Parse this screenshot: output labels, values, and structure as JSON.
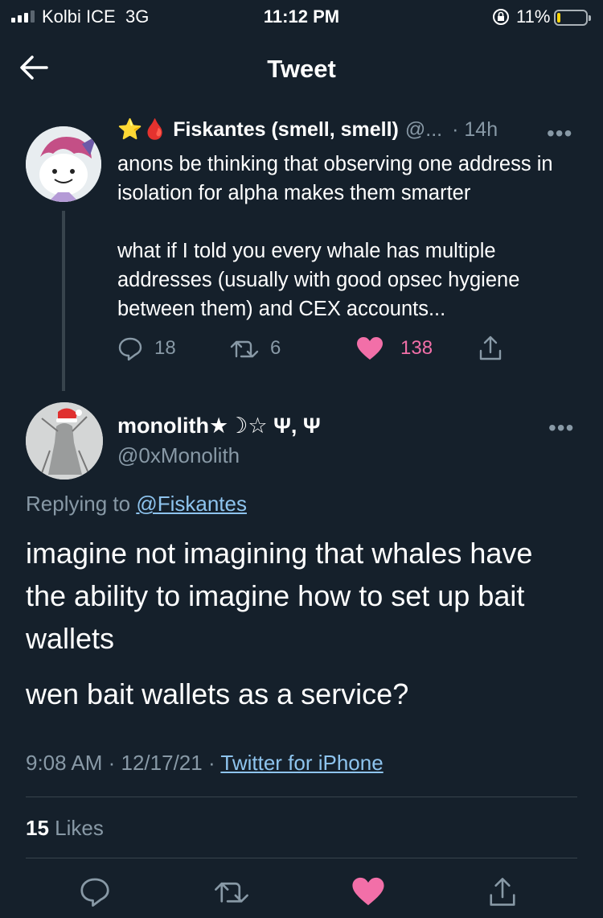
{
  "status_bar": {
    "carrier": "Kolbi ICE",
    "network": "3G",
    "time": "11:12 PM",
    "battery_pct": "11%",
    "battery_level": 0.11
  },
  "nav": {
    "title": "Tweet"
  },
  "parent_tweet": {
    "name": "⭐🩸 Fiskantes (smell, smell)",
    "handle": "@...",
    "time": "· 14h",
    "text": "anons be thinking that observing one address in isolation for alpha makes them smarter\n\nwhat if I told you every whale has multiple addresses (usually with good opsec hygiene between them) and CEX accounts...",
    "replies": "18",
    "retweets": "6",
    "likes": "138"
  },
  "main_tweet": {
    "name": "monolith★☽☆ Ψ, Ψ",
    "handle": "@0xMonolith",
    "replying_prefix": "Replying to",
    "replying_to": "@Fiskantes",
    "text_1": "imagine not imagining that whales have the ability to imagine how to set up bait wallets",
    "text_2": "wen bait wallets as a service?",
    "time": "9:08 AM",
    "date": "12/17/21",
    "source": "Twitter for iPhone",
    "like_count": "15",
    "like_label": "Likes"
  },
  "colors": {
    "background": "#15202b",
    "secondary_text": "#8899a6",
    "link": "#8ec4ee",
    "like_pink": "#f26fa8",
    "divider": "#38444d"
  },
  "icons": [
    "signal-icon",
    "lock-rotation-icon",
    "battery-icon",
    "back-arrow-icon",
    "more-icon",
    "reply-icon",
    "retweet-icon",
    "heart-icon",
    "share-icon"
  ]
}
